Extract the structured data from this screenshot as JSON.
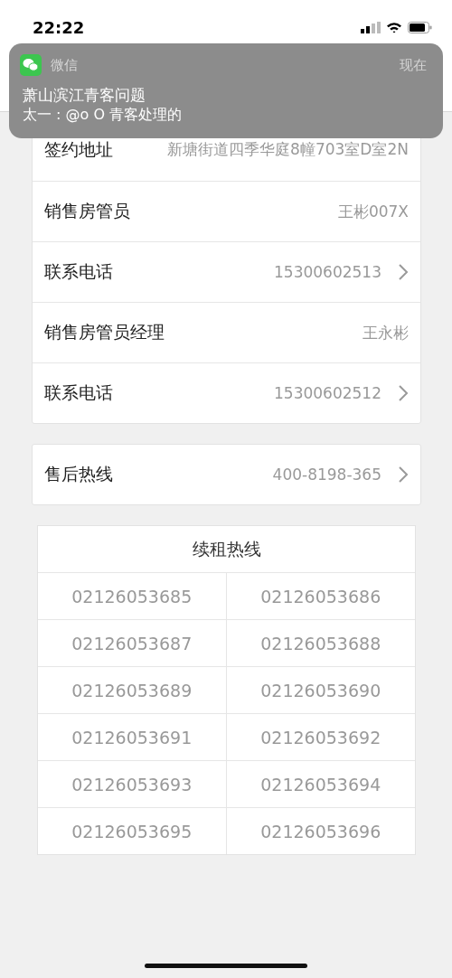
{
  "status_bar": {
    "time": "22:22"
  },
  "notification": {
    "app": "微信",
    "time": "现在",
    "title": "萧山滨江青客问题",
    "message": "太一 : @o O 青客处理的"
  },
  "cards": [
    {
      "rows": [
        {
          "label": "签约地址",
          "value": "新塘街道四季华庭8幢703室D室2N",
          "link": false
        },
        {
          "label": "销售房管员",
          "value": "王彬007X",
          "link": false
        },
        {
          "label": "联系电话",
          "value": "15300602513",
          "link": true
        },
        {
          "label": "销售房管员经理",
          "value": "王永彬",
          "link": false
        },
        {
          "label": "联系电话",
          "value": "15300602512",
          "link": true
        }
      ]
    },
    {
      "rows": [
        {
          "label": "售后热线",
          "value": "400-8198-365",
          "link": true
        }
      ]
    }
  ],
  "hotline_table": {
    "title": "续租热线",
    "rows": [
      [
        "02126053685",
        "02126053686"
      ],
      [
        "02126053687",
        "02126053688"
      ],
      [
        "02126053689",
        "02126053690"
      ],
      [
        "02126053691",
        "02126053692"
      ],
      [
        "02126053693",
        "02126053694"
      ],
      [
        "02126053695",
        "02126053696"
      ]
    ]
  }
}
